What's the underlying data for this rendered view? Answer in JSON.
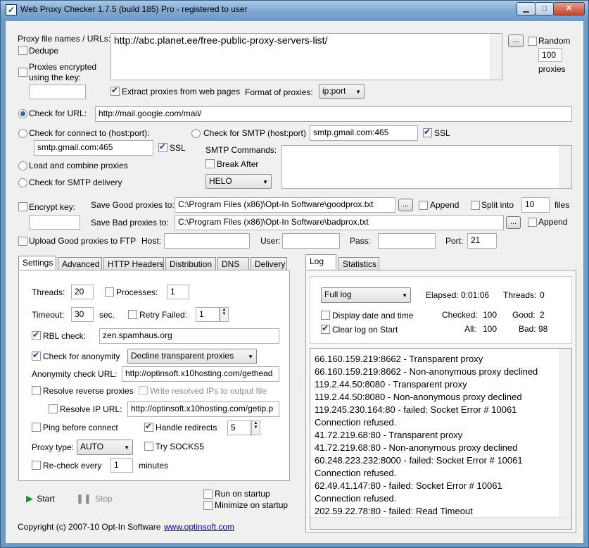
{
  "window": {
    "title": "Web Proxy Checker 1.7.5 (build 185) Pro - registered to user"
  },
  "source": {
    "label": "Proxy file names / URLs:",
    "url": "http://abc.planet.ee/free-public-proxy-servers-list/",
    "browse": "...",
    "dedupe": "Dedupe",
    "random": "Random",
    "random_count": "100",
    "proxies_label": "proxies",
    "encrypted": "Proxies encrypted using the key:",
    "extract": "Extract proxies from web pages",
    "format_label": "Format of proxies:",
    "format_value": "ip:port"
  },
  "checks": {
    "url_label": "Check for URL:",
    "url_value": "http://mail.google.com/mail/",
    "connect_label": "Check for connect to (host:port):",
    "connect_value": "smtp.gmail.com:465",
    "connect_ssl": "SSL",
    "smtp_label": "Check for SMTP (host:port)",
    "smtp_value": "smtp.gmail.com:465",
    "smtp_ssl": "SSL",
    "smtp_commands": "SMTP Commands:",
    "break_after": "Break After",
    "helo": "HELO",
    "load_combine": "Load and combine proxies",
    "smtp_delivery": "Check for SMTP delivery"
  },
  "save": {
    "encrypt_key": "Encrypt key:",
    "good_label": "Save Good proxies to:",
    "good_path": "C:\\Program Files (x86)\\Opt-In Software\\goodprox.txt",
    "bad_label": "Save Bad proxies to:",
    "bad_path": "C:\\Program Files (x86)\\Opt-In Software\\badprox.txt",
    "append": "Append",
    "split_into": "Split into",
    "split_count": "10",
    "files": "files",
    "browse": "..."
  },
  "ftp": {
    "upload": "Upload Good proxies to FTP",
    "host": "Host:",
    "user": "User:",
    "pass": "Pass:",
    "port": "Port:",
    "port_value": "21"
  },
  "tabs": [
    "Settings",
    "Advanced",
    "HTTP Headers",
    "Distribution",
    "DNS",
    "Delivery"
  ],
  "settings": {
    "threads_label": "Threads:",
    "threads": "20",
    "processes_label": "Processes:",
    "processes": "1",
    "timeout_label": "Timeout:",
    "timeout": "30",
    "sec": "sec.",
    "retry_label": "Retry Failed:",
    "retry": "1",
    "rbl_label": "RBL check:",
    "rbl_value": "zen.spamhaus.org",
    "anon_label": "Check for anonymity",
    "anon_value": "Decline transparent proxies",
    "anon_url_label": "Anonymity check URL:",
    "anon_url": "http://optinsoft.x10hosting.com/gethead",
    "resolve_reverse": "Resolve reverse proxies",
    "write_resolved": "Write resolved IPs to output file",
    "resolve_ip_label": "Resolve IP URL:",
    "resolve_ip_url": "http://optinsoft.x10hosting.com/getip.p",
    "ping": "Ping before connect",
    "redirects": "Handle redirects",
    "redirects_count": "5",
    "proxy_type_label": "Proxy type:",
    "proxy_type": "AUTO",
    "socks": "Try SOCKS5",
    "recheck": "Re-check every",
    "recheck_value": "1",
    "minutes": "minutes"
  },
  "actions": {
    "start": "Start",
    "stop": "Stop",
    "run_startup": "Run on startup",
    "min_startup": "Minimize on startup"
  },
  "footer": {
    "copyright": "Copyright (c) 2007-10 Opt-In Software",
    "link": "www.optinsoft.com"
  },
  "log_tabs": [
    "Log",
    "Statistics"
  ],
  "log": {
    "mode": "Full log",
    "display_date": "Display date and time",
    "clear_log": "Clear log on Start",
    "elapsed_label": "Elapsed:",
    "elapsed": "0:01:06",
    "threads_label": "Threads:",
    "threads": "0",
    "checked_label": "Checked:",
    "checked": "100",
    "good_label": "Good:",
    "good": "2",
    "all_label": "All:",
    "all": "100",
    "bad_label": "Bad:",
    "bad": "98",
    "lines": [
      "66.160.159.219:8662 - Transparent proxy",
      "66.160.159.219:8662 - Non-anonymous proxy declined",
      "119.2.44.50:8080 - Transparent proxy",
      "119.2.44.50:8080 - Non-anonymous proxy declined",
      "119.245.230.164:80 - failed: Socket Error # 10061",
      "Connection refused.",
      "41.72.219.68:80 - Transparent proxy",
      "41.72.219.68:80 - Non-anonymous proxy declined",
      "60.248.223.232:8000 - failed: Socket Error # 10061",
      "Connection refused.",
      "62.49.41.147:80 - failed: Socket Error # 10061",
      "Connection refused.",
      "202.59.22.78:80 - failed: Read Timeout"
    ]
  },
  "colors": {
    "titlebar": "#7fa9d2",
    "face": "#f0f0f0",
    "accent": "#2864b4"
  }
}
